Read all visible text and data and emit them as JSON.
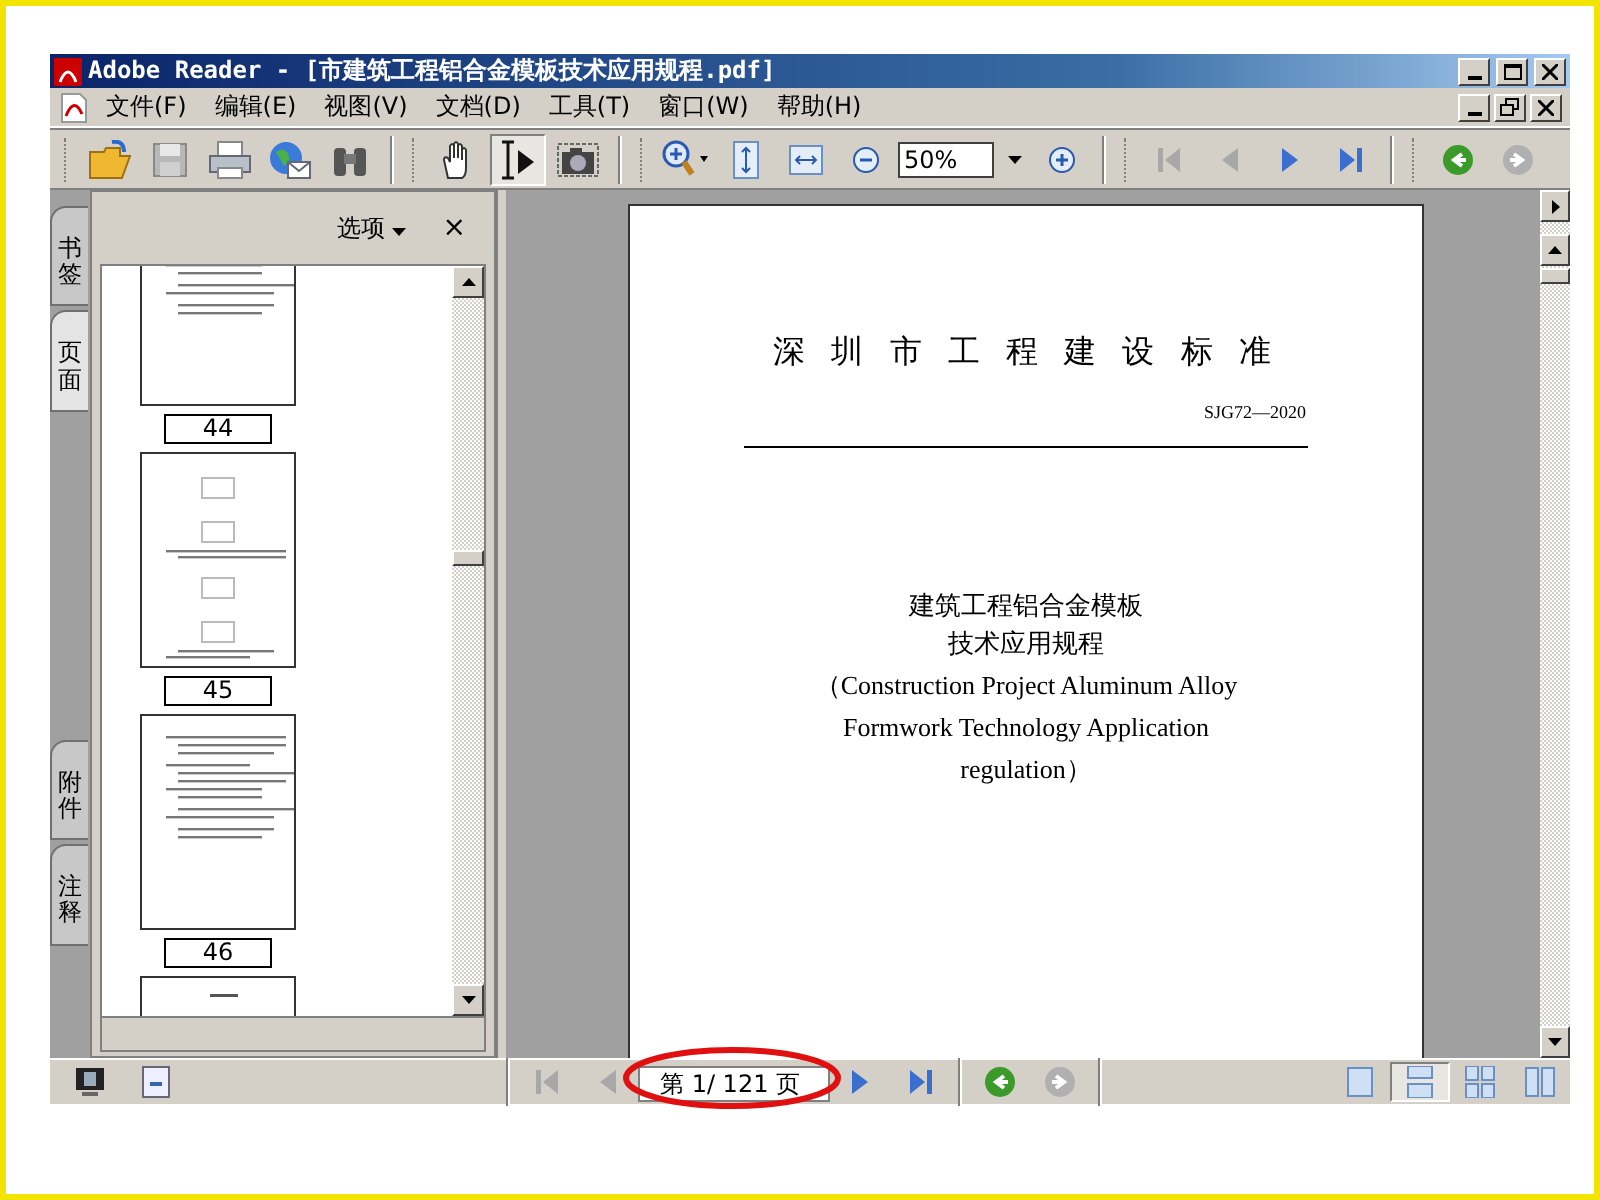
{
  "window": {
    "title": "Adobe Reader - [市建筑工程铝合金模板技术应用规程.pdf]"
  },
  "menu": [
    {
      "label": "文件(F)"
    },
    {
      "label": "编辑(E)"
    },
    {
      "label": "视图(V)"
    },
    {
      "label": "文档(D)"
    },
    {
      "label": "工具(T)"
    },
    {
      "label": "窗口(W)"
    },
    {
      "label": "帮助(H)"
    }
  ],
  "toolbar": {
    "file_tools": [
      {
        "kind": "open"
      },
      {
        "kind": "save"
      },
      {
        "kind": "print"
      },
      {
        "kind": "email"
      },
      {
        "kind": "find"
      }
    ],
    "tools": [
      {
        "kind": "hand",
        "selected": false
      },
      {
        "kind": "select",
        "selected": true
      },
      {
        "kind": "snapshot",
        "selected": false
      }
    ],
    "zoom_value": "50%",
    "nav": [
      {
        "kind": "first",
        "disabled": true
      },
      {
        "kind": "prev",
        "disabled": true
      },
      {
        "kind": "next",
        "disabled": false
      },
      {
        "kind": "last",
        "disabled": false
      }
    ],
    "history": [
      {
        "kind": "back",
        "disabled": false
      },
      {
        "kind": "forward",
        "disabled": true
      }
    ]
  },
  "side_tabs": [
    {
      "label": "书签",
      "selected": false
    },
    {
      "label": "页面",
      "selected": true
    },
    {
      "label": "附件",
      "selected": false
    },
    {
      "label": "注释",
      "selected": false
    }
  ],
  "panel": {
    "options": "选项",
    "close": "×",
    "thumbnails": [
      {
        "kind": "text",
        "label": "44"
      },
      {
        "kind": "figure",
        "label": "45"
      },
      {
        "kind": "text",
        "label": "46"
      },
      {
        "kind": "table"
      }
    ]
  },
  "document": {
    "heading": "深 圳 市 工 程 建 设 标 准",
    "code": "SJG72—2020",
    "title_lines": [
      "建筑工程铝合金模板",
      "技术应用规程"
    ],
    "english_lines": [
      "（Construction Project Aluminum Alloy",
      "Formwork Technology Application",
      "regulation）"
    ]
  },
  "status": {
    "nav": [
      {
        "kind": "first",
        "disabled": true
      },
      {
        "kind": "prev",
        "disabled": true
      },
      {
        "kind": "next",
        "disabled": false
      },
      {
        "kind": "last",
        "disabled": false
      }
    ],
    "page_field": "第 1/ 121 页",
    "history": [
      {
        "kind": "back",
        "disabled": false
      },
      {
        "kind": "forward",
        "disabled": true
      }
    ],
    "layouts": [
      {
        "kind": "single",
        "selected": false
      },
      {
        "kind": "continuous",
        "selected": true
      },
      {
        "kind": "continuous-facing",
        "selected": false
      },
      {
        "kind": "facing",
        "selected": false
      }
    ]
  }
}
